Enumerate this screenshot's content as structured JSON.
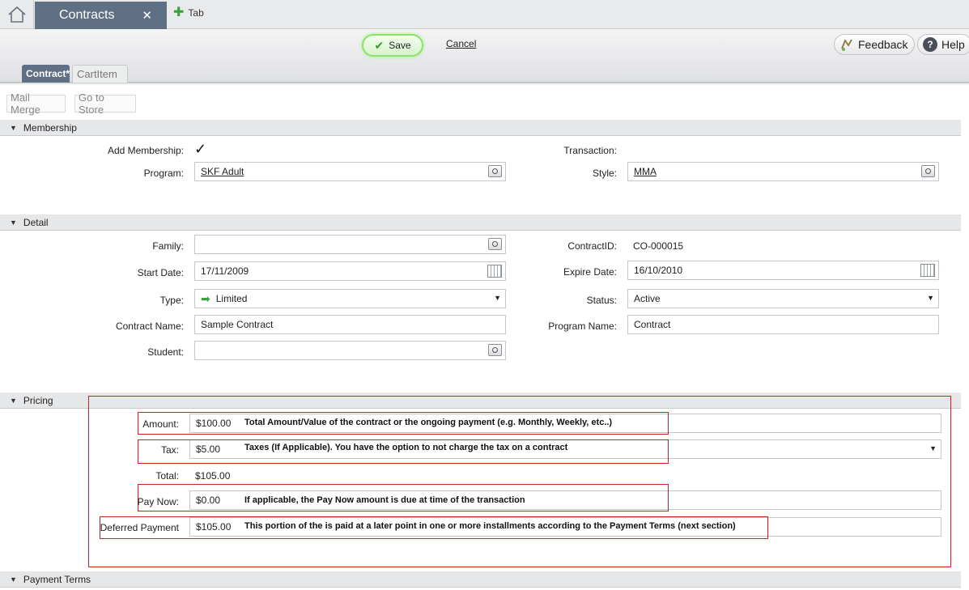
{
  "tabs": {
    "main_tab_label": "Contracts",
    "close_glyph": "✕",
    "add_tab_label": "Tab"
  },
  "toolbar": {
    "save_label": "Save",
    "cancel_label": "Cancel",
    "feedback_label": "Feedback",
    "help_label": "Help"
  },
  "sub_tabs": [
    {
      "label": "Contract*",
      "active": true
    },
    {
      "label": "CartItem",
      "active": false
    }
  ],
  "actions": {
    "mail_merge": "Mail Merge",
    "go_to_store": "Go to Store"
  },
  "membership": {
    "header": "Membership",
    "add_membership_label": "Add Membership:",
    "add_membership_checked": true,
    "program_label": "Program:",
    "program_value": "SKF Adult",
    "transaction_label": "Transaction:",
    "style_label": "Style:",
    "style_value": "MMA"
  },
  "detail": {
    "header": "Detail",
    "family_label": "Family:",
    "family_value": "",
    "start_date_label": "Start Date:",
    "start_date_value": "17/11/2009",
    "type_label": "Type:",
    "type_value": "Limited",
    "contract_name_label": "Contract Name:",
    "contract_name_value": "Sample Contract",
    "student_label": "Student:",
    "student_value": "",
    "contract_id_label": "ContractID:",
    "contract_id_value": "CO-000015",
    "expire_date_label": "Expire Date:",
    "expire_date_value": "16/10/2010",
    "status_label": "Status:",
    "status_value": "Active",
    "program_name_label": "Program Name:",
    "program_name_value": "Contract"
  },
  "pricing": {
    "header": "Pricing",
    "amount_label": "Amount:",
    "amount_value": "$100.00",
    "amount_note": "Total Amount/Value of the contract or the ongoing payment (e.g. Monthly, Weekly, etc..)",
    "tax_label": "Tax:",
    "tax_value": "$5.00",
    "tax_note": "Taxes (If Applicable). You have the option to not charge the tax on a contract",
    "total_label": "Total:",
    "total_value": "$105.00",
    "pay_now_label": "Pay Now:",
    "pay_now_value": "$0.00",
    "pay_now_note": "If applicable, the Pay Now amount is due at time of the transaction",
    "deferred_label": "Deferred Payment",
    "deferred_value": "$105.00",
    "deferred_note": "This portion of the is paid at a later point in one or more installments according to the Payment Terms (next section)"
  },
  "payment_terms": {
    "header": "Payment Terms"
  },
  "colors": {
    "tab_active": "#5f6f84",
    "annotation_red": "#d41f1f",
    "save_glow": "#8be36a"
  }
}
